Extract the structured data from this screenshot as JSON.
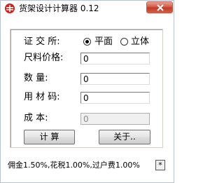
{
  "window": {
    "title": "货架设计计算器 0.12"
  },
  "form": {
    "exchange_label": "证 交 所:",
    "option_flat": "平面",
    "option_3d": "立体",
    "size_label": "尺料价格:",
    "size_value": "0",
    "qty_label": "数    量:",
    "qty_value": "0",
    "code_label": "用 材 码:",
    "code_value": "0",
    "cost_label": "成    本:",
    "cost_value": "0"
  },
  "buttons": {
    "calculate": "计  算",
    "about": "关于.."
  },
  "status": {
    "text": "佣金1.50%,花税1.00%,过户费1.00%",
    "star": "*"
  },
  "colors": {
    "close_red": "#c03a26",
    "icon_red": "#d0201a"
  },
  "icons": {
    "app": "app-icon",
    "close": "close-icon"
  }
}
